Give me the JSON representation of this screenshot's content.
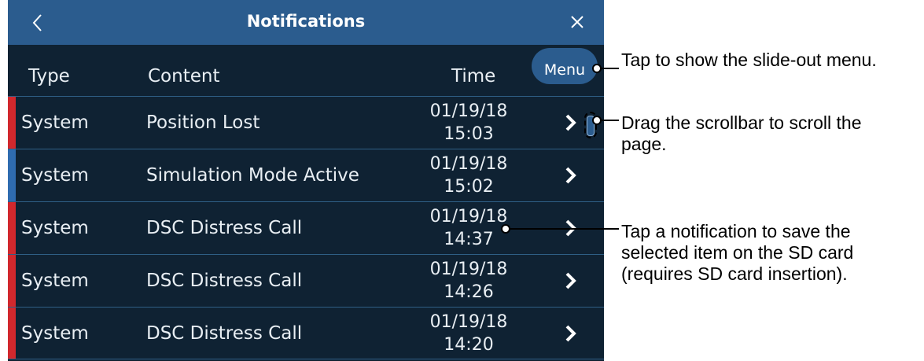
{
  "window": {
    "title": "Notifications",
    "back_icon": "chevron-left-icon",
    "close_icon": "close-icon"
  },
  "header": {
    "col_type": "Type",
    "col_content": "Content",
    "col_time": "Time",
    "menu_label": "Menu"
  },
  "colors": {
    "titlebar": "#2b5c8e",
    "background": "#0f2233",
    "stripe_red": "#d1282d",
    "stripe_blue": "#2f6cb0"
  },
  "rows": [
    {
      "type": "System",
      "content": "Position Lost",
      "date": "01/19/18",
      "time": "15:03",
      "stripe": "red"
    },
    {
      "type": "System",
      "content": "Simulation Mode Active",
      "date": "01/19/18",
      "time": "15:02",
      "stripe": "blue"
    },
    {
      "type": "System",
      "content": "DSC Distress Call",
      "date": "01/19/18",
      "time": "14:37",
      "stripe": "red"
    },
    {
      "type": "System",
      "content": "DSC Distress Call",
      "date": "01/19/18",
      "time": "14:26",
      "stripe": "red"
    },
    {
      "type": "System",
      "content": "DSC Distress Call",
      "date": "01/19/18",
      "time": "14:20",
      "stripe": "red"
    }
  ],
  "callouts": {
    "menu": "Tap to show the slide-out menu.",
    "scroll_line1": "Drag the scrollbar to scroll the",
    "scroll_line2": "page.",
    "tap_line1": "Tap a notification to save the",
    "tap_line2": "selected item on the SD card",
    "tap_line3": "(requires SD card insertion)."
  }
}
